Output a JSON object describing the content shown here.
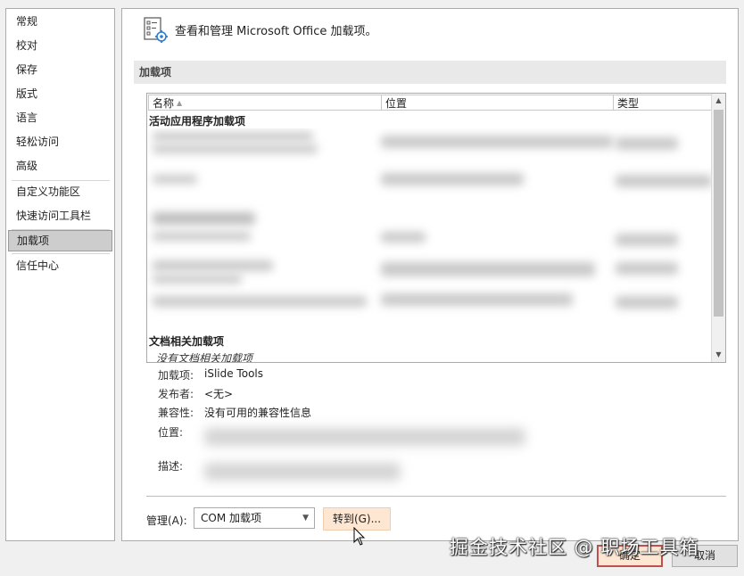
{
  "nav": {
    "items": [
      {
        "label": "常规"
      },
      {
        "label": "校对"
      },
      {
        "label": "保存"
      },
      {
        "label": "版式"
      },
      {
        "label": "语言"
      },
      {
        "label": "轻松访问"
      },
      {
        "label": "高级"
      },
      {
        "label": "自定义功能区"
      },
      {
        "label": "快速访问工具栏"
      },
      {
        "label": "加载项",
        "selected": true
      },
      {
        "label": "信任中心"
      }
    ]
  },
  "header": {
    "icon": "addins-settings-icon",
    "text": "查看和管理 Microsoft Office 加载项。"
  },
  "section": {
    "title": "加载项"
  },
  "list": {
    "columns": [
      {
        "label": "名称",
        "sorted": "ascending"
      },
      {
        "label": "位置"
      },
      {
        "label": "类型"
      }
    ],
    "groups": [
      {
        "title": "活动应用程序加载项"
      },
      {
        "title": "文档相关加载项",
        "empty_text": "没有文档相关加载项"
      }
    ]
  },
  "details": {
    "addin_label": "加载项:",
    "addin_value": "iSlide Tools",
    "publisher_label": "发布者:",
    "publisher_value": "<无>",
    "compat_label": "兼容性:",
    "compat_value": "没有可用的兼容性信息",
    "location_label": "位置:",
    "description_label": "描述:"
  },
  "manage": {
    "label": "管理(A):",
    "selected": "COM 加载项",
    "goto_label": "转到(G)..."
  },
  "footer": {
    "ok_label": "确定",
    "cancel_label": "取消"
  },
  "watermark": "掘金技术社区 @ 职场工具箱",
  "colors": {
    "selected_nav": "#cdcdcd",
    "goto_button": "#fde6d2",
    "ok_border": "#c0504d"
  }
}
